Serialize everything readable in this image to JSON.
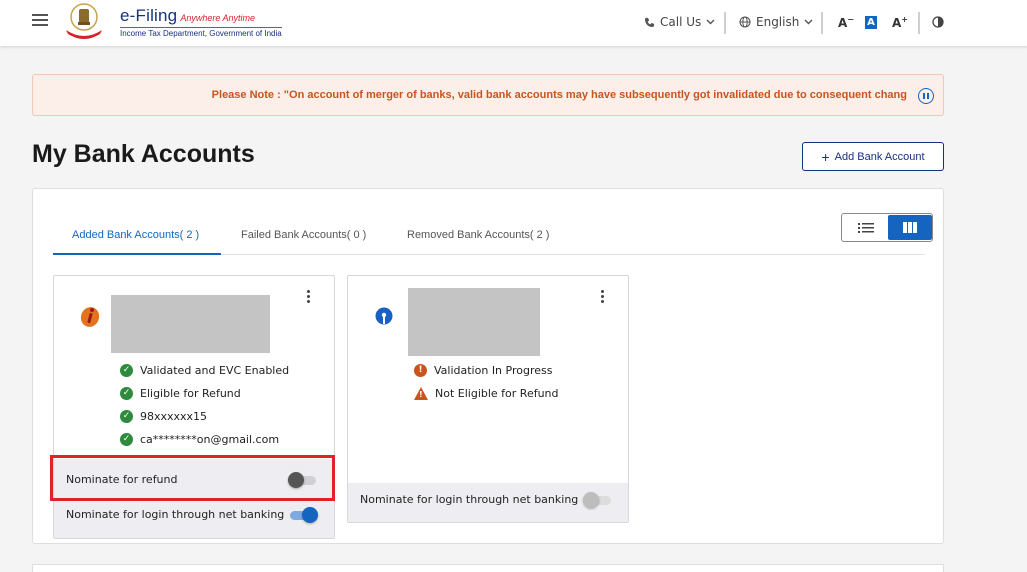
{
  "header": {
    "brand_title": "e-Filing",
    "brand_tagline": "Anywhere Anytime",
    "brand_subtitle": "Income Tax Department, Government of India",
    "call_us": "Call Us",
    "language": "English",
    "font_decrease": "A",
    "font_normal": "A",
    "font_increase": "A"
  },
  "notice": {
    "text": "Please Note : \"On account of merger of banks, valid bank accounts may have subsequently got invalidated due to consequent chang"
  },
  "page": {
    "title": "My Bank Accounts",
    "add_button": "Add Bank Account"
  },
  "tabs": [
    {
      "label": "Added Bank Accounts( 2 )"
    },
    {
      "label": "Failed Bank Accounts( 0 )"
    },
    {
      "label": "Removed Bank Accounts( 2 )"
    }
  ],
  "cards": [
    {
      "bank_icon": "icici-bank-logo",
      "statuses": [
        {
          "icon": "check-icon",
          "text": "Validated and EVC Enabled"
        },
        {
          "icon": "check-icon",
          "text": "Eligible for Refund"
        },
        {
          "icon": "check-icon",
          "text": "98xxxxxx15"
        },
        {
          "icon": "check-icon",
          "text": "ca********on@gmail.com"
        }
      ],
      "nominate_refund": {
        "label": "Nominate for refund",
        "state": "off"
      },
      "nominate_login": {
        "label": "Nominate for login through net banking",
        "state": "on"
      }
    },
    {
      "bank_icon": "sbi-bank-logo",
      "statuses": [
        {
          "icon": "error-icon",
          "text": "Validation In Progress"
        },
        {
          "icon": "warning-icon",
          "text": "Not Eligible for Refund"
        }
      ],
      "nominate_login": {
        "label": "Nominate for login through net banking",
        "state": "disabled"
      }
    }
  ],
  "colors": {
    "primary": "#1565c0",
    "brand_navy": "#17327c",
    "success": "#2e8b3e",
    "alert": "#c8541e",
    "highlight": "#e3202c"
  }
}
